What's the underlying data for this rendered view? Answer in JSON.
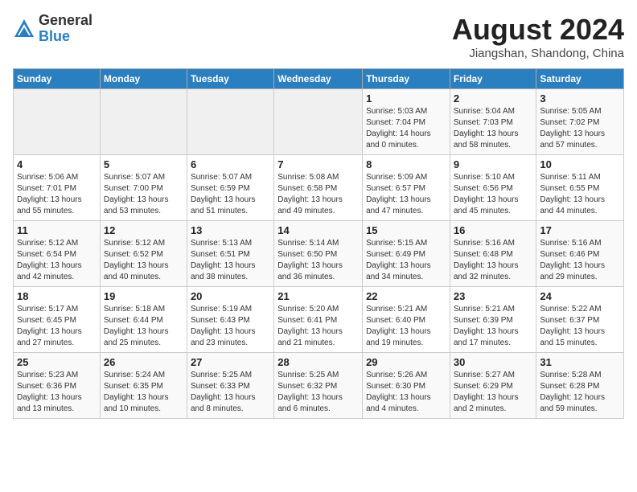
{
  "header": {
    "logo_general": "General",
    "logo_blue": "Blue",
    "month_year": "August 2024",
    "location": "Jiangshan, Shandong, China"
  },
  "weekdays": [
    "Sunday",
    "Monday",
    "Tuesday",
    "Wednesday",
    "Thursday",
    "Friday",
    "Saturday"
  ],
  "weeks": [
    [
      {
        "day": "",
        "details": ""
      },
      {
        "day": "",
        "details": ""
      },
      {
        "day": "",
        "details": ""
      },
      {
        "day": "",
        "details": ""
      },
      {
        "day": "1",
        "details": "Sunrise: 5:03 AM\nSunset: 7:04 PM\nDaylight: 14 hours\nand 0 minutes."
      },
      {
        "day": "2",
        "details": "Sunrise: 5:04 AM\nSunset: 7:03 PM\nDaylight: 13 hours\nand 58 minutes."
      },
      {
        "day": "3",
        "details": "Sunrise: 5:05 AM\nSunset: 7:02 PM\nDaylight: 13 hours\nand 57 minutes."
      }
    ],
    [
      {
        "day": "4",
        "details": "Sunrise: 5:06 AM\nSunset: 7:01 PM\nDaylight: 13 hours\nand 55 minutes."
      },
      {
        "day": "5",
        "details": "Sunrise: 5:07 AM\nSunset: 7:00 PM\nDaylight: 13 hours\nand 53 minutes."
      },
      {
        "day": "6",
        "details": "Sunrise: 5:07 AM\nSunset: 6:59 PM\nDaylight: 13 hours\nand 51 minutes."
      },
      {
        "day": "7",
        "details": "Sunrise: 5:08 AM\nSunset: 6:58 PM\nDaylight: 13 hours\nand 49 minutes."
      },
      {
        "day": "8",
        "details": "Sunrise: 5:09 AM\nSunset: 6:57 PM\nDaylight: 13 hours\nand 47 minutes."
      },
      {
        "day": "9",
        "details": "Sunrise: 5:10 AM\nSunset: 6:56 PM\nDaylight: 13 hours\nand 45 minutes."
      },
      {
        "day": "10",
        "details": "Sunrise: 5:11 AM\nSunset: 6:55 PM\nDaylight: 13 hours\nand 44 minutes."
      }
    ],
    [
      {
        "day": "11",
        "details": "Sunrise: 5:12 AM\nSunset: 6:54 PM\nDaylight: 13 hours\nand 42 minutes."
      },
      {
        "day": "12",
        "details": "Sunrise: 5:12 AM\nSunset: 6:52 PM\nDaylight: 13 hours\nand 40 minutes."
      },
      {
        "day": "13",
        "details": "Sunrise: 5:13 AM\nSunset: 6:51 PM\nDaylight: 13 hours\nand 38 minutes."
      },
      {
        "day": "14",
        "details": "Sunrise: 5:14 AM\nSunset: 6:50 PM\nDaylight: 13 hours\nand 36 minutes."
      },
      {
        "day": "15",
        "details": "Sunrise: 5:15 AM\nSunset: 6:49 PM\nDaylight: 13 hours\nand 34 minutes."
      },
      {
        "day": "16",
        "details": "Sunrise: 5:16 AM\nSunset: 6:48 PM\nDaylight: 13 hours\nand 32 minutes."
      },
      {
        "day": "17",
        "details": "Sunrise: 5:16 AM\nSunset: 6:46 PM\nDaylight: 13 hours\nand 29 minutes."
      }
    ],
    [
      {
        "day": "18",
        "details": "Sunrise: 5:17 AM\nSunset: 6:45 PM\nDaylight: 13 hours\nand 27 minutes."
      },
      {
        "day": "19",
        "details": "Sunrise: 5:18 AM\nSunset: 6:44 PM\nDaylight: 13 hours\nand 25 minutes."
      },
      {
        "day": "20",
        "details": "Sunrise: 5:19 AM\nSunset: 6:43 PM\nDaylight: 13 hours\nand 23 minutes."
      },
      {
        "day": "21",
        "details": "Sunrise: 5:20 AM\nSunset: 6:41 PM\nDaylight: 13 hours\nand 21 minutes."
      },
      {
        "day": "22",
        "details": "Sunrise: 5:21 AM\nSunset: 6:40 PM\nDaylight: 13 hours\nand 19 minutes."
      },
      {
        "day": "23",
        "details": "Sunrise: 5:21 AM\nSunset: 6:39 PM\nDaylight: 13 hours\nand 17 minutes."
      },
      {
        "day": "24",
        "details": "Sunrise: 5:22 AM\nSunset: 6:37 PM\nDaylight: 13 hours\nand 15 minutes."
      }
    ],
    [
      {
        "day": "25",
        "details": "Sunrise: 5:23 AM\nSunset: 6:36 PM\nDaylight: 13 hours\nand 13 minutes."
      },
      {
        "day": "26",
        "details": "Sunrise: 5:24 AM\nSunset: 6:35 PM\nDaylight: 13 hours\nand 10 minutes."
      },
      {
        "day": "27",
        "details": "Sunrise: 5:25 AM\nSunset: 6:33 PM\nDaylight: 13 hours\nand 8 minutes."
      },
      {
        "day": "28",
        "details": "Sunrise: 5:25 AM\nSunset: 6:32 PM\nDaylight: 13 hours\nand 6 minutes."
      },
      {
        "day": "29",
        "details": "Sunrise: 5:26 AM\nSunset: 6:30 PM\nDaylight: 13 hours\nand 4 minutes."
      },
      {
        "day": "30",
        "details": "Sunrise: 5:27 AM\nSunset: 6:29 PM\nDaylight: 13 hours\nand 2 minutes."
      },
      {
        "day": "31",
        "details": "Sunrise: 5:28 AM\nSunset: 6:28 PM\nDaylight: 12 hours\nand 59 minutes."
      }
    ]
  ]
}
